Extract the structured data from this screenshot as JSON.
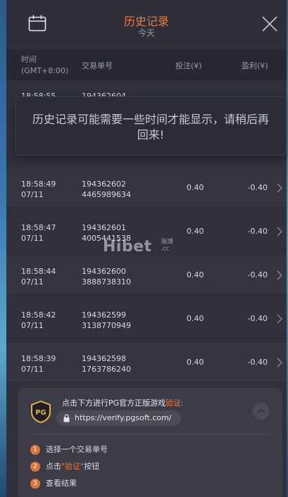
{
  "header": {
    "title": "历史记录",
    "subtitle": "今天"
  },
  "table": {
    "col_time_line1": "时间",
    "col_time_line2": "(GMT+8:00)",
    "col_id": "交易单号",
    "col_bet": "投注(¥)",
    "col_profit": "盈利(¥)",
    "rows": [
      {
        "time": "18:58:55",
        "date": "",
        "id1": "194362604",
        "id2": "",
        "bet": "",
        "profit": ""
      },
      {
        "time": "18:58:49",
        "date": "07/11",
        "id1": "194362602",
        "id2": "4465989634",
        "bet": "0.40",
        "profit": "-0.40"
      },
      {
        "time": "18:58:47",
        "date": "07/11",
        "id1": "194362601",
        "id2": "4005441538",
        "bet": "0.40",
        "profit": "-0.40"
      },
      {
        "time": "18:58:44",
        "date": "07/11",
        "id1": "194362600",
        "id2": "3888738310",
        "bet": "0.40",
        "profit": "-0.40"
      },
      {
        "time": "18:58:42",
        "date": "07/11",
        "id1": "194362599",
        "id2": "3138770949",
        "bet": "0.40",
        "profit": "-0.40"
      },
      {
        "time": "18:58:39",
        "date": "07/11",
        "id1": "194362598",
        "id2": "1763786240",
        "bet": "0.40",
        "profit": "-0.40"
      }
    ]
  },
  "toast": {
    "message": "历史记录可能需要一些时间才能显示，请稍后再回来!"
  },
  "watermark": {
    "text": "Hibet",
    "side_text_top": "海博",
    "side_text_bottom": ".cc"
  },
  "verify": {
    "title_prefix": "点击下方进行PG官方正版游戏",
    "title_highlight": "验证:",
    "url": "https://verify.pgsoft.com/",
    "steps": [
      {
        "num": "1",
        "before": "选择一个交易单号",
        "highlight": "",
        "after": ""
      },
      {
        "num": "2",
        "before": "点击",
        "highlight": "\"验证\"",
        "after": "按钮"
      },
      {
        "num": "3",
        "before": "查看结果",
        "highlight": "",
        "after": ""
      }
    ]
  },
  "colors": {
    "accent": "#ee7b3f",
    "background": "#30313d",
    "text": "#d8d9e0"
  },
  "icons": {
    "calendar": "calendar-icon",
    "close": "close-icon",
    "chevron": "chevron-right-icon",
    "lock": "lock-icon",
    "collapse": "chevron-up-icon",
    "logo": "pg-logo-icon"
  }
}
